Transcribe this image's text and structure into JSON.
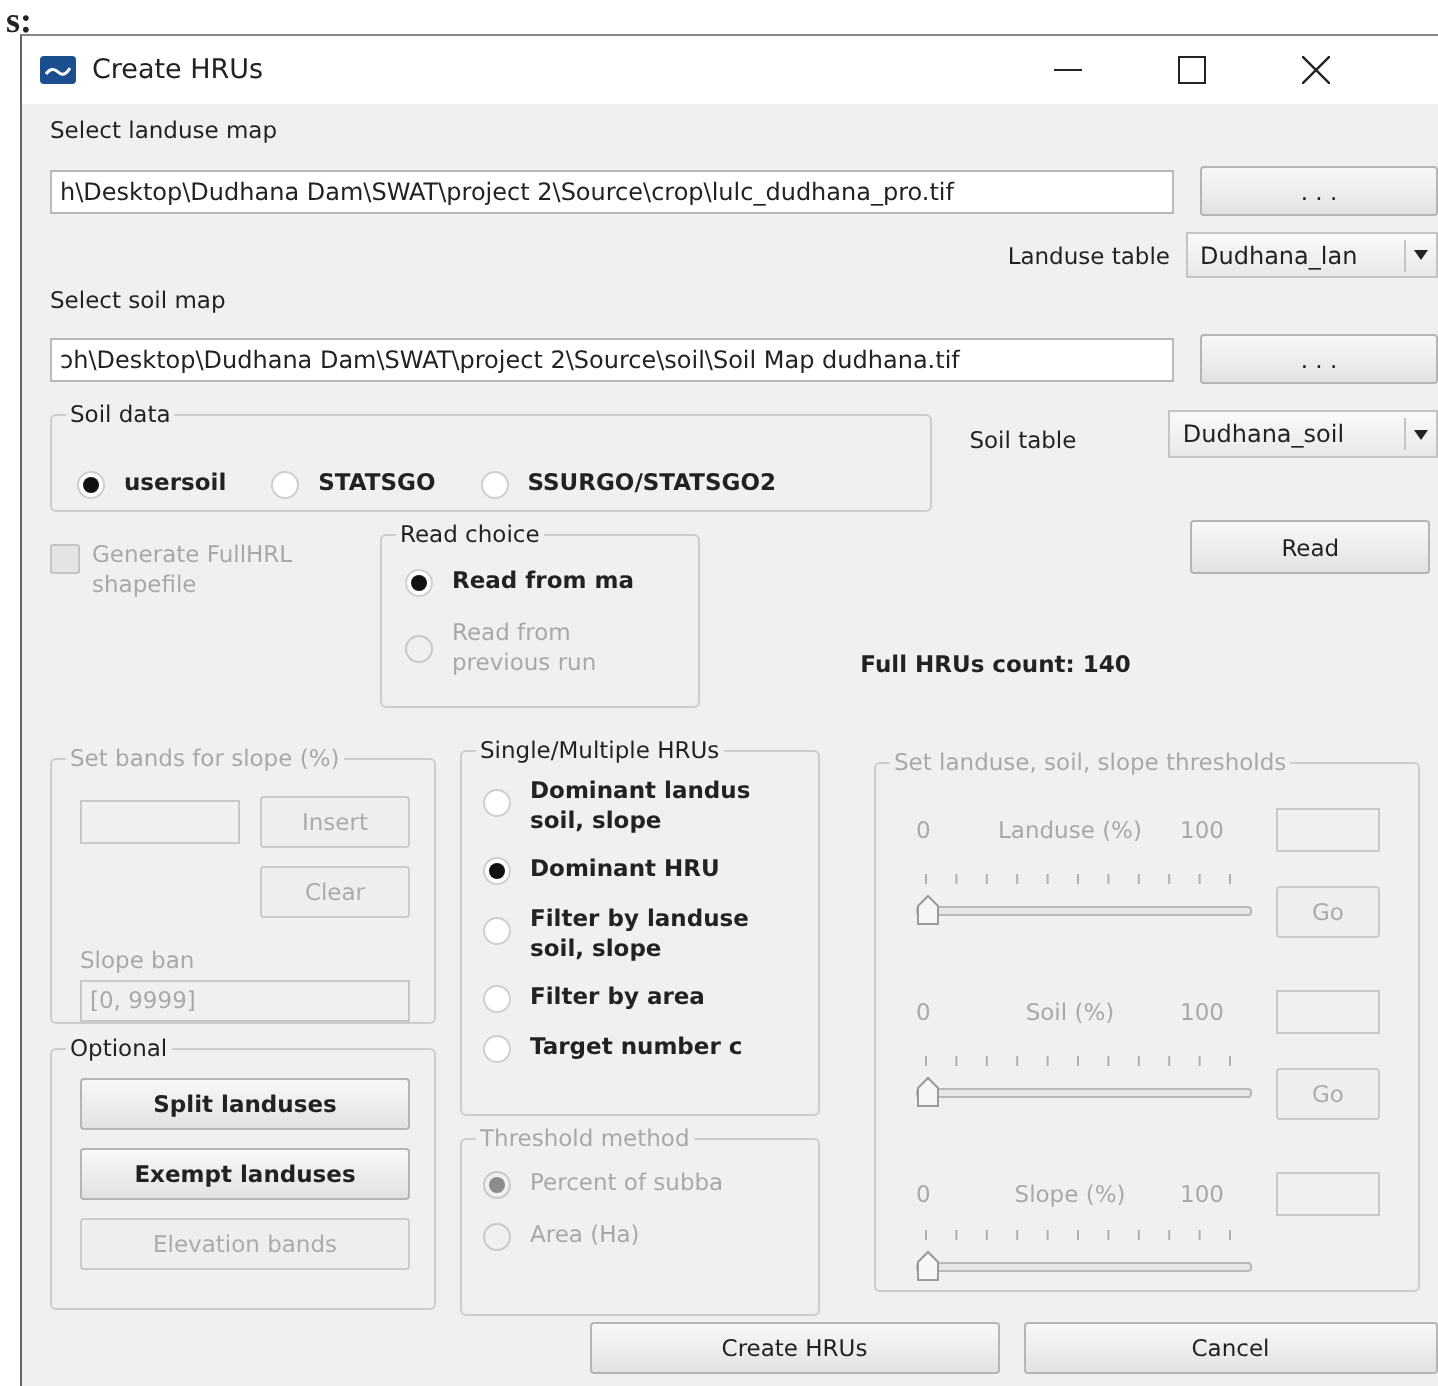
{
  "caption_fragment": "s:",
  "window": {
    "title": "Create HRUs"
  },
  "landuse_map": {
    "label": "Select landuse map",
    "path": "h\\Desktop\\Dudhana Dam\\SWAT\\project 2\\Source\\crop\\lulc_dudhana_pro.tif",
    "browse_button": ". . ."
  },
  "landuse_table": {
    "label": "Landuse table",
    "value": "Dudhana_lan"
  },
  "soil_map": {
    "label": "Select soil map",
    "path": "ɔh\\Desktop\\Dudhana Dam\\SWAT\\project 2\\Source\\soil\\Soil Map dudhana.tif",
    "browse_button": ". . ."
  },
  "soil_data": {
    "title": "Soil data",
    "options": [
      {
        "label": "usersoil",
        "selected": true
      },
      {
        "label": "STATSGO",
        "selected": false
      },
      {
        "label": "SSURGO/STATSGO2",
        "selected": false
      }
    ]
  },
  "soil_table": {
    "label": "Soil table",
    "value": "Dudhana_soil"
  },
  "generate_shapefile": {
    "label": "Generate FullHRL\nshapefile",
    "checked": false,
    "disabled": true
  },
  "read_choice": {
    "title": "Read choice",
    "options": [
      {
        "label": "Read from ma",
        "selected": true,
        "disabled": false
      },
      {
        "label": "Read from\nprevious run",
        "selected": false,
        "disabled": true
      }
    ]
  },
  "read_button": "Read",
  "hru_count": "Full HRUs count: 140",
  "slope_bands": {
    "title": "Set bands for slope (%)",
    "disabled": true,
    "insert_button": "Insert",
    "clear_button": "Clear",
    "bands_label": "Slope ban",
    "bands_value": "[0, 9999]"
  },
  "optional": {
    "title": "Optional",
    "buttons": [
      {
        "label": "Split landuses",
        "disabled": false
      },
      {
        "label": "Exempt landuses",
        "disabled": false
      },
      {
        "label": "Elevation bands",
        "disabled": true
      }
    ]
  },
  "hru_mode": {
    "title": "Single/Multiple HRUs",
    "options": [
      {
        "label": "Dominant landus\nsoil, slope",
        "selected": false
      },
      {
        "label": "Dominant HRU",
        "selected": true
      },
      {
        "label": "Filter by landuse\nsoil, slope",
        "selected": false
      },
      {
        "label": "Filter by area",
        "selected": false
      },
      {
        "label": "Target number c",
        "selected": false
      }
    ]
  },
  "threshold_method": {
    "title": "Threshold method",
    "disabled": true,
    "options": [
      {
        "label": "Percent of subba",
        "selected": true
      },
      {
        "label": "Area (Ha)",
        "selected": false
      }
    ]
  },
  "thresholds": {
    "title": "Set landuse, soil, slope thresholds",
    "disabled": true,
    "rows": [
      {
        "min": "0",
        "label": "Landuse (%)",
        "max": "100",
        "level": 0,
        "go_button": "Go"
      },
      {
        "min": "0",
        "label": "Soil (%)",
        "max": "100",
        "level": 0,
        "go_button": "Go"
      },
      {
        "min": "0",
        "label": "Slope (%)",
        "max": "100",
        "level": 0
      }
    ]
  },
  "buttons": [
    {
      "label": "Create HRUs"
    },
    {
      "label": "Cancel"
    }
  ]
}
